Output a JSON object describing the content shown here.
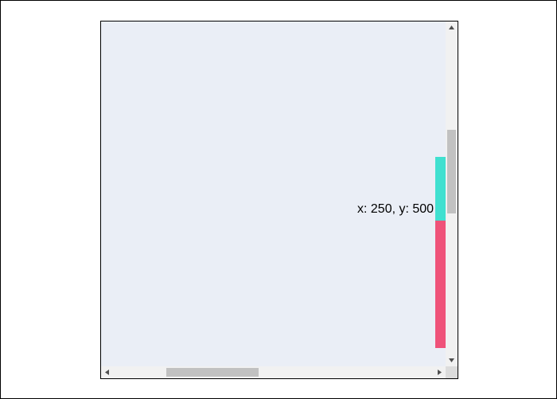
{
  "scroll_area": {
    "background": "#eaeef6",
    "coordinate_readout": "x: 250, y: 500"
  },
  "bars": [
    {
      "name": "teal-bar",
      "color": "#40e0d0"
    },
    {
      "name": "pink-bar",
      "color": "#ef5279"
    }
  ],
  "scrollbars": {
    "vertical": {
      "up_icon": "triangle-up-icon",
      "down_icon": "triangle-down-icon"
    },
    "horizontal": {
      "left_icon": "triangle-left-icon",
      "right_icon": "triangle-right-icon"
    },
    "track_color": "#f1f1f1",
    "thumb_color": "#c1c1c1"
  }
}
